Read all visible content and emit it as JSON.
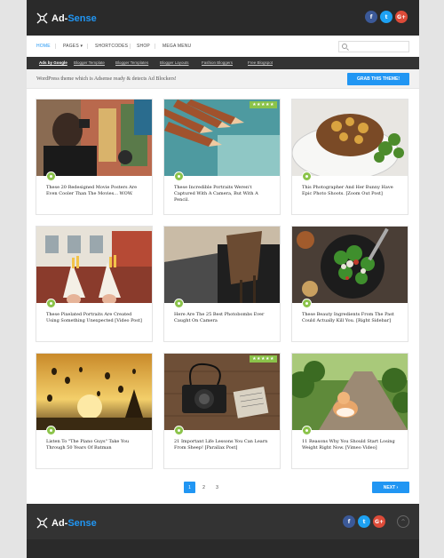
{
  "brand": {
    "name_part1": "Ad-",
    "name_part2": "Sense"
  },
  "social": {
    "facebook": "f",
    "twitter": "t",
    "google": "G+"
  },
  "nav": {
    "items": [
      {
        "label": "HOME"
      },
      {
        "label": "PAGES ▾"
      },
      {
        "label": "SHORTCODES"
      },
      {
        "label": "SHOP"
      },
      {
        "label": "MEGA MENU"
      }
    ],
    "search_placeholder": ""
  },
  "topbar": {
    "items": [
      "Ads by Google",
      "Blogger Template",
      "Blogger Templates",
      "Blogger Layouts",
      "Fashion Bloggers",
      "Free Blogspot"
    ]
  },
  "promo": {
    "text": "WordPress theme which is Adsense ready & detects Ad Blockers!",
    "button": "GRAB THIS THEME!"
  },
  "posts": [
    {
      "title": "These 20 Redesigned Movie Posters Are Even Cooler Than The Movies... WOW."
    },
    {
      "title": "These Incredible Portraits Weren't Captured With A Camera, But With A Pencil.",
      "stars": "★★★★★"
    },
    {
      "title": "This Photographer And Her Bunny Have Epic Photo Shoots. [Zoom Out Post]"
    },
    {
      "title": "These Pixelated Portraits Are Created Using Something Unexpected [Video Post]"
    },
    {
      "title": "Here Are The 25 Best Photobombs Ever Caught On Camera"
    },
    {
      "title": "These Beauty Ingredients From The Past Could Actually Kill You. [Right Sidebar]"
    },
    {
      "title": "Listen To \"The Piano Guys\" Take You Through 50 Years Of Batman"
    },
    {
      "title": "21 Important Life Lessons You Can Learn From Sheep! [Parallax Post]",
      "stars": "★★★★★"
    },
    {
      "title": "11 Reasons Why You Should Start Losing Weight Right Now. [Vimeo Video]"
    }
  ],
  "pagination": {
    "pages": [
      "1",
      "2",
      "3"
    ],
    "next": "NEXT ›"
  },
  "footer": {
    "to_top": "^"
  },
  "colors": {
    "accent": "#2196f3",
    "category": "#8bc34a",
    "header": "#2a2a2a"
  }
}
